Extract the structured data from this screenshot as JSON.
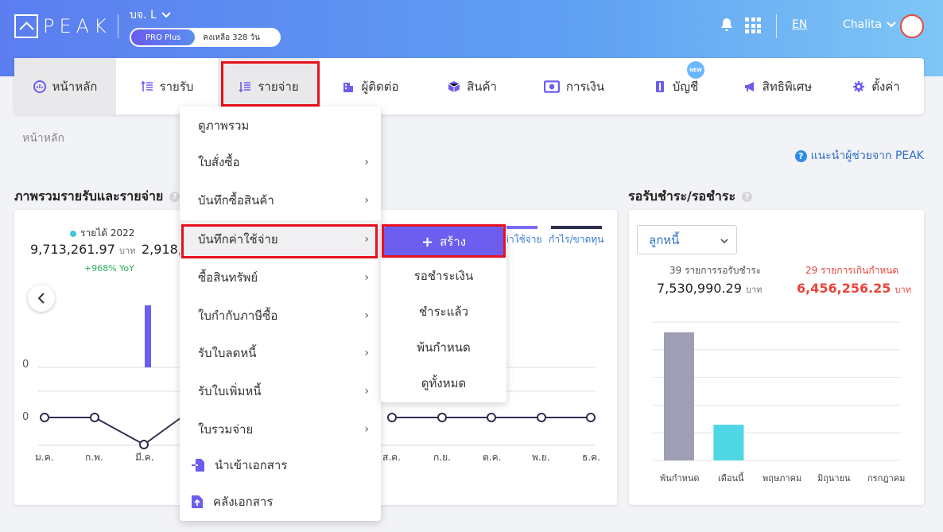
{
  "header": {
    "logo_text": "PEAK",
    "company": "บจ. L",
    "plan": "PRO Plus",
    "remaining": "คงเหลือ 328 วัน",
    "lang": "EN",
    "user": "Chalita"
  },
  "nav": {
    "items": [
      {
        "label": "หน้าหลัก",
        "icon": "dashboard-icon"
      },
      {
        "label": "รายรับ",
        "icon": "income-icon"
      },
      {
        "label": "รายจ่าย",
        "icon": "expense-icon"
      },
      {
        "label": "ผู้ติดต่อ",
        "icon": "contacts-icon"
      },
      {
        "label": "สินค้า",
        "icon": "product-icon"
      },
      {
        "label": "การเงิน",
        "icon": "finance-icon"
      },
      {
        "label": "บัญชี",
        "icon": "accounting-icon"
      },
      {
        "label": "สิทธิพิเศษ",
        "icon": "privilege-icon"
      },
      {
        "label": "ตั้งค่า",
        "icon": "settings-icon"
      }
    ],
    "new_badge": "NEW"
  },
  "breadcrumb": "หน้าหลัก",
  "help_link": "แนะนำผู้ช่วยจาก PEAK",
  "overview": {
    "title": "ภาพรวมรายรับและรายจ่าย",
    "legend_income": "รายได้ 2022",
    "income_value": "9,713,261.97",
    "unit": "บาท",
    "income_yoy": "+968% YoY",
    "expense_value_partial": "2,918,",
    "legend_expense_partial": "ค่าใช้จ่าย",
    "legend_profit": "กำไร/ขาดทุน",
    "axis_zero_top": "0",
    "axis_zero_bottom": "0",
    "months": [
      "ม.ค.",
      "ก.พ.",
      "มี.ค.",
      "ส.ค.",
      "ก.ย.",
      "ต.ค.",
      "พ.ย.",
      "ธ.ค."
    ]
  },
  "receivables": {
    "title": "รอรับชำระ/รอชำระ",
    "select_value": "ลูกหนี้",
    "pending_label": "39 รายการรอรับชำระ",
    "pending_value": "7,530,990.29",
    "overdue_label": "29 รายการเกินกำหนด",
    "overdue_value": "6,456,256.25",
    "unit": "บาท",
    "categories": [
      "พ้นกำหนด",
      "เดือนนี้",
      "พฤษภาคม",
      "มิถุนายน",
      "กรกฎาคม"
    ]
  },
  "chart_data": {
    "type": "bar",
    "categories": [
      "พ้นกำหนด",
      "เดือนนี้",
      "พฤษภาคม",
      "มิถุนายน",
      "กรกฎาคม"
    ],
    "values": [
      6456256.25,
      1800000,
      0,
      0,
      0
    ],
    "colors": [
      "#9e9eb4",
      "#4fd6e4",
      "#9e9eb4",
      "#9e9eb4",
      "#9e9eb4"
    ]
  },
  "expense_menu": {
    "items": [
      {
        "label": "ดูภาพรวม",
        "chevron": false
      },
      {
        "label": "ใบสั่งซื้อ",
        "chevron": true
      },
      {
        "label": "บันทึกซื้อสินค้า",
        "chevron": true
      },
      {
        "label": "บันทึกค่าใช้จ่าย",
        "chevron": true
      },
      {
        "label": "ซื้อสินทรัพย์",
        "chevron": true
      },
      {
        "label": "ใบกำกับภาษีซื้อ",
        "chevron": true
      },
      {
        "label": "รับใบลดหนี้",
        "chevron": true
      },
      {
        "label": "รับใบเพิ่มหนี้",
        "chevron": true
      },
      {
        "label": "ใบรวมจ่าย",
        "chevron": true
      },
      {
        "label": "นำเข้าเอกสาร",
        "chevron": false
      },
      {
        "label": "คลังเอกสาร",
        "chevron": false
      }
    ],
    "chevron_glyph": "›"
  },
  "expense_submenu": {
    "create": "สร้าง",
    "items": [
      "รอชำระเงิน",
      "ชำระแล้ว",
      "พ้นกำหนด",
      "ดูทั้งหมด"
    ]
  },
  "colors": {
    "accent": "#6d5ef0",
    "overdue": "#e8453a",
    "highlight": "#e8101e"
  }
}
